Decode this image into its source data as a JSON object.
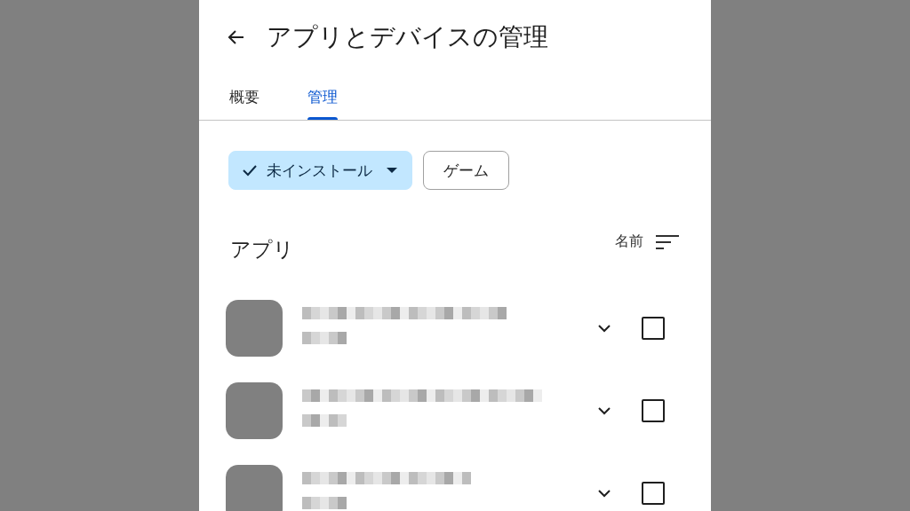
{
  "header": {
    "title": "アプリとデバイスの管理"
  },
  "tabs": [
    {
      "label": "概要",
      "selected": false
    },
    {
      "label": "管理",
      "selected": true
    }
  ],
  "filters": [
    {
      "label": "未インストール",
      "selected": true,
      "kind": "dropdown"
    },
    {
      "label": "ゲーム",
      "selected": false,
      "kind": "chip"
    }
  ],
  "section": {
    "title": "アプリ",
    "sort_label": "名前"
  }
}
